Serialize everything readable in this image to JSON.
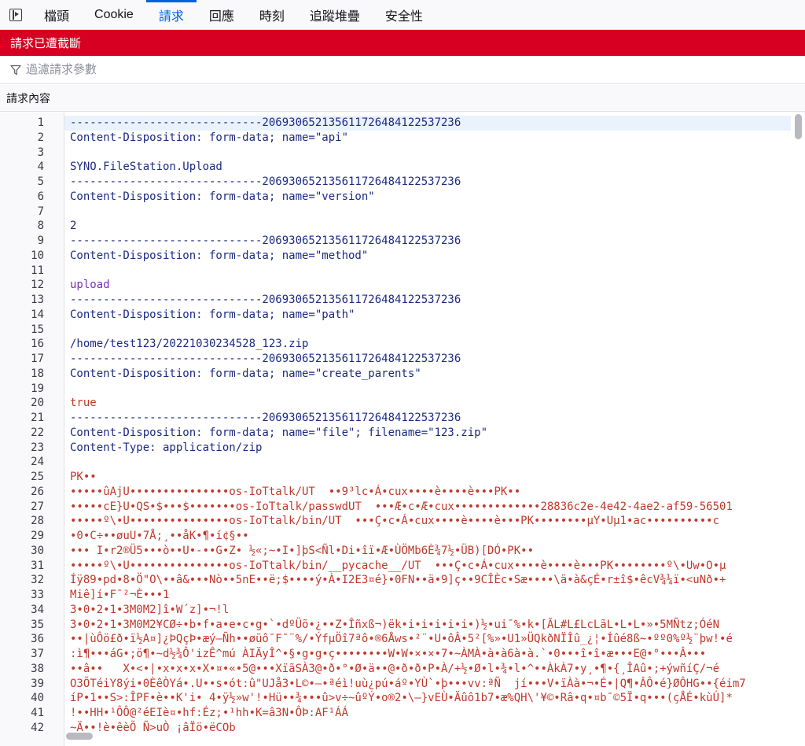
{
  "tabs": [
    {
      "label": "檔頭",
      "active": false
    },
    {
      "label": "Cookie",
      "active": false
    },
    {
      "label": "請求",
      "active": true
    },
    {
      "label": "回應",
      "active": false
    },
    {
      "label": "時刻",
      "active": false
    },
    {
      "label": "追蹤堆疊",
      "active": false
    },
    {
      "label": "安全性",
      "active": false
    }
  ],
  "banner": {
    "text": "請求已遭截斷"
  },
  "filter": {
    "placeholder": "過濾請求參數",
    "icon": "filter-icon"
  },
  "section": {
    "title": "請求內容"
  },
  "colors": {
    "accent": "#0061e0",
    "banner": "#d70022"
  },
  "editor": {
    "lines": [
      {
        "n": "1",
        "cls": "c-navy",
        "text": "-----------------------------206930652135611726484122537236"
      },
      {
        "n": "2",
        "cls": "c-navy",
        "text": "Content-Disposition: form-data; name=\"api\""
      },
      {
        "n": "3",
        "cls": "c-navy",
        "text": ""
      },
      {
        "n": "4",
        "cls": "c-navy",
        "text": "SYNO.FileStation.Upload"
      },
      {
        "n": "5",
        "cls": "c-navy",
        "text": "-----------------------------206930652135611726484122537236"
      },
      {
        "n": "6",
        "cls": "c-navy",
        "text": "Content-Disposition: form-data; name=\"version\""
      },
      {
        "n": "7",
        "cls": "c-navy",
        "text": ""
      },
      {
        "n": "8",
        "cls": "c-navy",
        "text": "2"
      },
      {
        "n": "9",
        "cls": "c-navy",
        "text": "-----------------------------206930652135611726484122537236"
      },
      {
        "n": "10",
        "cls": "c-navy",
        "text": "Content-Disposition: form-data; name=\"method\""
      },
      {
        "n": "11",
        "cls": "c-navy",
        "text": ""
      },
      {
        "n": "12",
        "cls": "c-purple",
        "text": "upload"
      },
      {
        "n": "13",
        "cls": "c-navy",
        "text": "-----------------------------206930652135611726484122537236"
      },
      {
        "n": "14",
        "cls": "c-navy",
        "text": "Content-Disposition: form-data; name=\"path\""
      },
      {
        "n": "15",
        "cls": "c-navy",
        "text": ""
      },
      {
        "n": "16",
        "cls": "c-navy",
        "text": "/home/test123/20221030234528_123.zip"
      },
      {
        "n": "17",
        "cls": "c-navy",
        "text": "-----------------------------206930652135611726484122537236"
      },
      {
        "n": "18",
        "cls": "c-navy",
        "text": "Content-Disposition: form-data; name=\"create_parents\""
      },
      {
        "n": "19",
        "cls": "c-navy",
        "text": ""
      },
      {
        "n": "20",
        "cls": "c-red",
        "text": "true"
      },
      {
        "n": "21",
        "cls": "c-navy",
        "text": "-----------------------------206930652135611726484122537236"
      },
      {
        "n": "22",
        "cls": "c-navy",
        "text": "Content-Disposition: form-data; name=\"file\"; filename=\"123.zip\""
      },
      {
        "n": "23",
        "cls": "c-navy",
        "text": "Content-Type: application/zip"
      },
      {
        "n": "24",
        "cls": "c-navy",
        "text": ""
      },
      {
        "n": "25",
        "cls": "c-red",
        "text": "PK••"
      },
      {
        "n": "26",
        "cls": "c-red",
        "text": "•••••ûAjU•••••••••••••••os-IoTtalk/UT  ••9³lc•Á•cux••••è••••è•••PK••"
      },
      {
        "n": "27",
        "cls": "c-red",
        "text": "•••••cE}U•QS•$•••$•••••••os-IoTtalk/passwdUT  •••Æ•c•Æ•cux•••••••••••••28836c2e-4e42-4ae2-af59-56501"
      },
      {
        "n": "28",
        "cls": "c-red",
        "text": "•••••º\\•U•••••••••••••••os-IoTtalk/bin/UT  •••Ç•c•Á•cux••••è••••è•••PK••••••••µY•Uµ1•ac••••••••••c"
      },
      {
        "n": "29",
        "cls": "c-red",
        "text": "•0•C÷••øuU•7Å;¸••åK•¶•í¢§••"
      },
      {
        "n": "30",
        "cls": "c-red",
        "text": "••• I•r2®Ü5•••ò••U•-••G•Z• ½«;~•I•]þS<Ñl•Di•îï•Æ•ÙÖMb6È¾7½•ÜB)[DÓ•PK••"
      },
      {
        "n": "31",
        "cls": "c-red",
        "text": "•••••º\\•U•••••••••••••••os-IoTtalk/bin/__pycache__/UT  •••Ç•c•Á•cux••••è••••è•••PK••••••••º\\•Uw•O•µ"
      },
      {
        "n": "32",
        "cls": "c-red",
        "text": "Íÿ89•pd•8•Ö\"O\\••â&•••Nò••5nE••ë;$••••ý•À•I2E3¤é}•0FN••ä•9]ç••9CÎÈc•Sæ••••\\ä•à&çÉ•r±î$•êcV¾¼ï•<uNð•+"
      },
      {
        "n": "33",
        "cls": "c-red",
        "text": "Miê]í•F¯²¬È•••1"
      },
      {
        "n": "34",
        "cls": "c-red",
        "text": "3•0•2•1•3M0M2]î•W´z]•¬!l"
      },
      {
        "n": "35",
        "cls": "c-red",
        "text": "3•0•2•1•3M0M2¥CØ÷•b•f•a•e•c•g•`•dºÜõ•¿••Z•Îñxß¬)ëk•i•i•i•i•i•)½•ui¯%•k•[ÃL#L£LcLãL•L•L•»•5MÑtz;ÓéN"
      },
      {
        "n": "36",
        "cls": "c-red",
        "text": "••|ùÔö£ð•ï½A¤]¿ÞQçÞ•æý–Ñh••øüô¯F¯¨%/•ÝfµÖî7ªô•®6Åws•²¨•U•ôÂ•5²[%»•U1»ÜQkðNÏÎû_¿¦•Íûé8ß~•ºº0%º½¨þw!•é"
      },
      {
        "n": "37",
        "cls": "c-red",
        "text": ":ì¶•••áG•;ö¶•~d½¾Ô'izÊ^mú ÀIÄyÎ^•§•g•g•ç••••••••W•W•×•×•7•~ÀMÀ•à•à6à•à.`•0•••î•î•æ•••E@•°•••Â•••"
      },
      {
        "n": "38",
        "cls": "c-red",
        "text": "••â••   X•<•|•x•x•x•X•¤•«•5@•••XïãSÀ3@•ð•°•Ø•ä••@•ð•ð•P•À/+½•Ø•l•¾•l•^••ÀkÀ7•y¸•¶•{¸ÎAû•;+ýwñíÇ/¬é"
      },
      {
        "n": "39",
        "cls": "c-red",
        "text": "O3ÕTéiY8ýi•0ÈêÒYá•.U••s•ót:û\"UJå3•L©•—•ªéì!uù¿pú•áº•YÙ`•þ•••vv:ªÑ  jí•••V•ïÀà•¬•É•|Q¶•ÂÔ•é}ØÔHG••{éim7"
      },
      {
        "n": "40",
        "cls": "c-red",
        "text": "íP•1••S>:ÎPF•è••K'i• 4•ÿ½»w'!•Hü••¾•••û>v÷~ûºÝ•o®2•\\—}vEÙ•Äûô1b7•æ%QH\\'¥©•Râ•q•¤b¯©5Ï•q•••(çÅÉ•kùÚ]*"
      },
      {
        "n": "41",
        "cls": "c-red",
        "text": "!••HH•¹ÔÔ@²éEIè¤•hf:Éz;•¹hh•K=â3N•ÔÞ:AF¹ÁÁ"
      },
      {
        "n": "42",
        "cls": "c-red",
        "text": "~Ä••!è•êèÕ Ñ>uÒ ¡âÏö•ëCOb"
      }
    ]
  }
}
